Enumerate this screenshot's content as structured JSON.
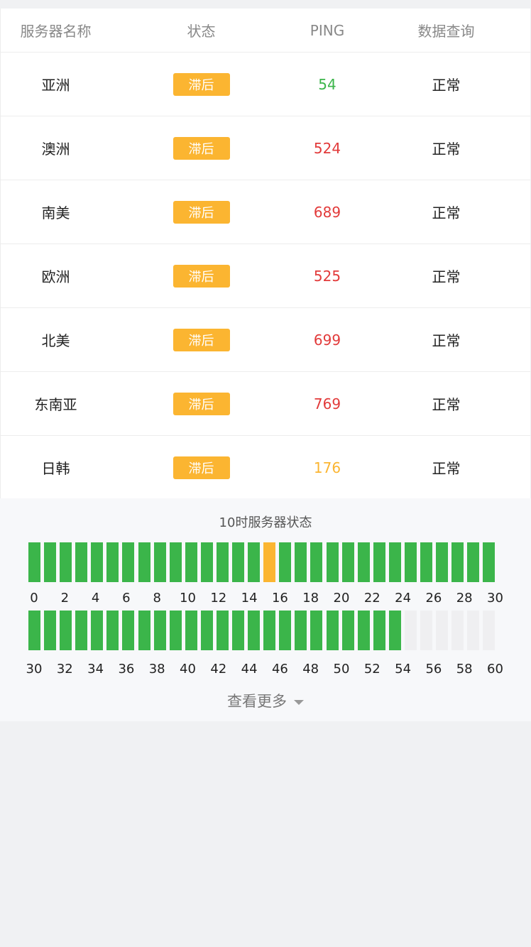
{
  "header": {
    "name": "服务器名称",
    "status": "状态",
    "ping": "PING",
    "query": "数据查询"
  },
  "rows": [
    {
      "name": "亚洲",
      "status": "滞后",
      "ping": "54",
      "ping_color": "#3bb54a",
      "query": "正常"
    },
    {
      "name": "澳洲",
      "status": "滞后",
      "ping": "524",
      "ping_color": "#e23a3a",
      "query": "正常"
    },
    {
      "name": "南美",
      "status": "滞后",
      "ping": "689",
      "ping_color": "#e23a3a",
      "query": "正常"
    },
    {
      "name": "欧洲",
      "status": "滞后",
      "ping": "525",
      "ping_color": "#e23a3a",
      "query": "正常"
    },
    {
      "name": "北美",
      "status": "滞后",
      "ping": "699",
      "ping_color": "#e23a3a",
      "query": "正常"
    },
    {
      "name": "东南亚",
      "status": "滞后",
      "ping": "769",
      "ping_color": "#e23a3a",
      "query": "正常"
    },
    {
      "name": "日韩",
      "status": "滞后",
      "ping": "176",
      "ping_color": "#fbb531",
      "query": "正常"
    }
  ],
  "status_panel": {
    "title": "10时服务器状态",
    "more_label": "查看更多",
    "colors": {
      "ok": "#3bb54a",
      "warn": "#fbb531",
      "empty": "#efeff1"
    },
    "row1_states": [
      "ok",
      "ok",
      "ok",
      "ok",
      "ok",
      "ok",
      "ok",
      "ok",
      "ok",
      "ok",
      "ok",
      "ok",
      "ok",
      "ok",
      "ok",
      "warn",
      "ok",
      "ok",
      "ok",
      "ok",
      "ok",
      "ok",
      "ok",
      "ok",
      "ok",
      "ok",
      "ok",
      "ok",
      "ok",
      "ok"
    ],
    "row2_states": [
      "ok",
      "ok",
      "ok",
      "ok",
      "ok",
      "ok",
      "ok",
      "ok",
      "ok",
      "ok",
      "ok",
      "ok",
      "ok",
      "ok",
      "ok",
      "ok",
      "ok",
      "ok",
      "ok",
      "ok",
      "ok",
      "ok",
      "ok",
      "ok",
      "empty",
      "empty",
      "empty",
      "empty",
      "empty",
      "empty"
    ],
    "row1_ticks": [
      "0",
      "2",
      "4",
      "6",
      "8",
      "10",
      "12",
      "14",
      "16",
      "18",
      "20",
      "22",
      "24",
      "26",
      "28",
      "30"
    ],
    "row2_ticks": [
      "30",
      "32",
      "34",
      "36",
      "38",
      "40",
      "42",
      "44",
      "46",
      "48",
      "50",
      "52",
      "54",
      "56",
      "58",
      "60"
    ]
  },
  "status_badge_color": "#fbb531"
}
